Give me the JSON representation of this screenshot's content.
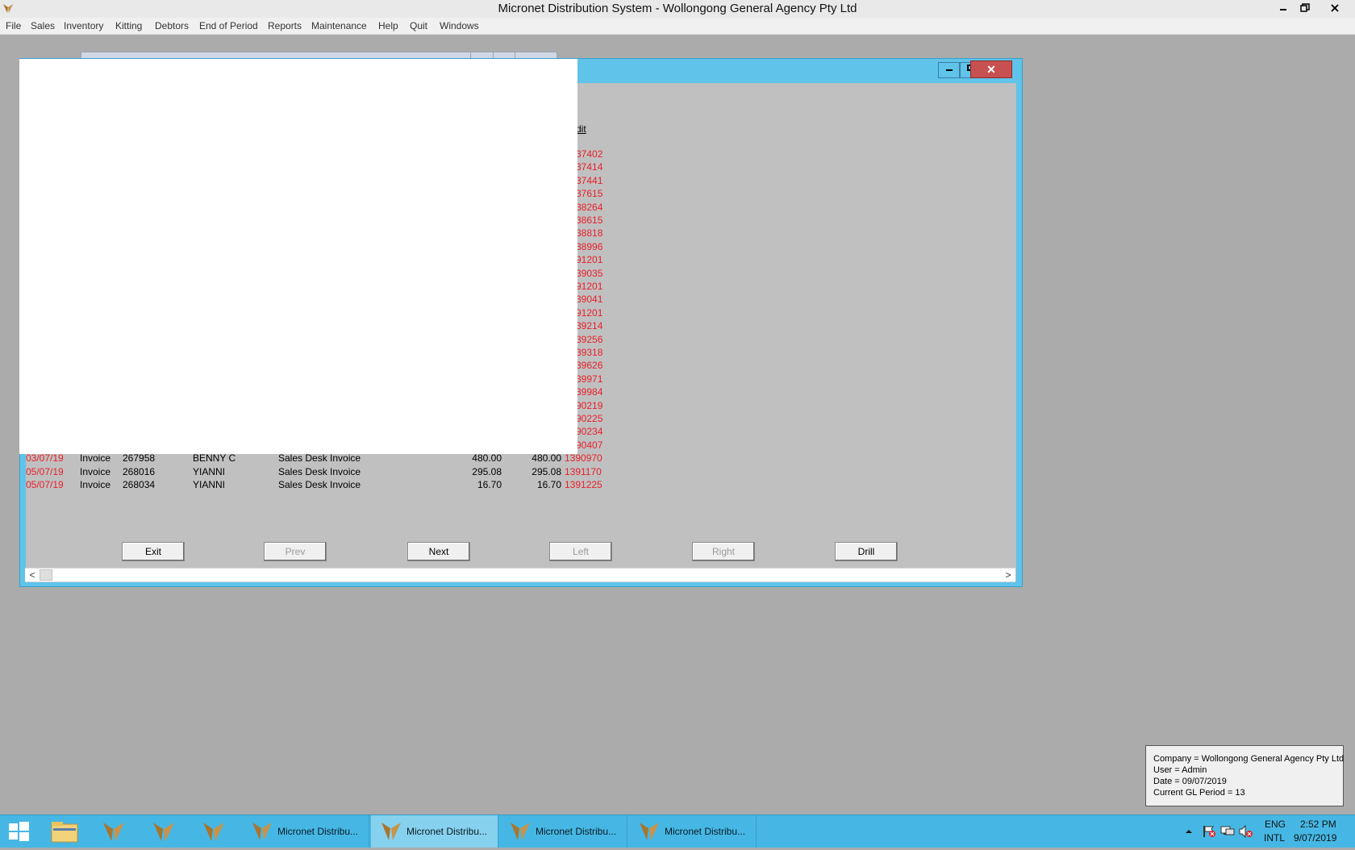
{
  "app": {
    "title": "Micronet Distribution System - Wollongong General Agency Pty Ltd"
  },
  "menu": [
    "File",
    "Sales",
    "Inventory",
    "Kitting",
    "Debtors",
    "End of Period",
    "Reports",
    "Maintenance",
    "Help",
    "Quit",
    "Windows"
  ],
  "window": {
    "close_glyph": "✕",
    "credit_header": "dit"
  },
  "partial_numbers": [
    "37402",
    "37414",
    "37441",
    "37615",
    "38264",
    "38615",
    "38818",
    "38996",
    "91201",
    "39035",
    "91201",
    "39041",
    "91201",
    "39214",
    "39256",
    "39318",
    "39626",
    "39971",
    "39984",
    "90219",
    "90225",
    "90234",
    "90407"
  ],
  "rows": [
    {
      "date": "03/07/19",
      "type": "Invoice",
      "ref": "267958",
      "customer": "BENNY C",
      "desc": "Sales Desk Invoice",
      "amount": "480.00",
      "balance": "480.00",
      "number": "1390970"
    },
    {
      "date": "05/07/19",
      "type": "Invoice",
      "ref": "268016",
      "customer": "YIANNI",
      "desc": "Sales Desk Invoice",
      "amount": "295.08",
      "balance": "295.08",
      "number": "1391170"
    },
    {
      "date": "05/07/19",
      "type": "Invoice",
      "ref": "268034",
      "customer": "YIANNI",
      "desc": "Sales Desk Invoice",
      "amount": "16.70",
      "balance": "16.70",
      "number": "1391225"
    }
  ],
  "buttons": {
    "exit": "Exit",
    "prev": "Prev",
    "next": "Next",
    "left": "Left",
    "right": "Right",
    "drill": "Drill"
  },
  "info": {
    "company": "Company = Wollongong General Agency Pty Ltd",
    "user": "User = Admin",
    "date": "Date = 09/07/2019",
    "period": "Current GL Period = 13"
  },
  "taskbar": {
    "tasks": [
      "Micronet Distribu...",
      "Micronet Distribu...",
      "Micronet Distribu...",
      "Micronet Distribu..."
    ],
    "lang1": "ENG",
    "lang2": "INTL",
    "time": "2:52 PM",
    "date": "9/07/2019"
  },
  "colors": {
    "accent": "#5fc3ea",
    "taskbar": "#46b7e4",
    "red_text": "#e8202a"
  }
}
